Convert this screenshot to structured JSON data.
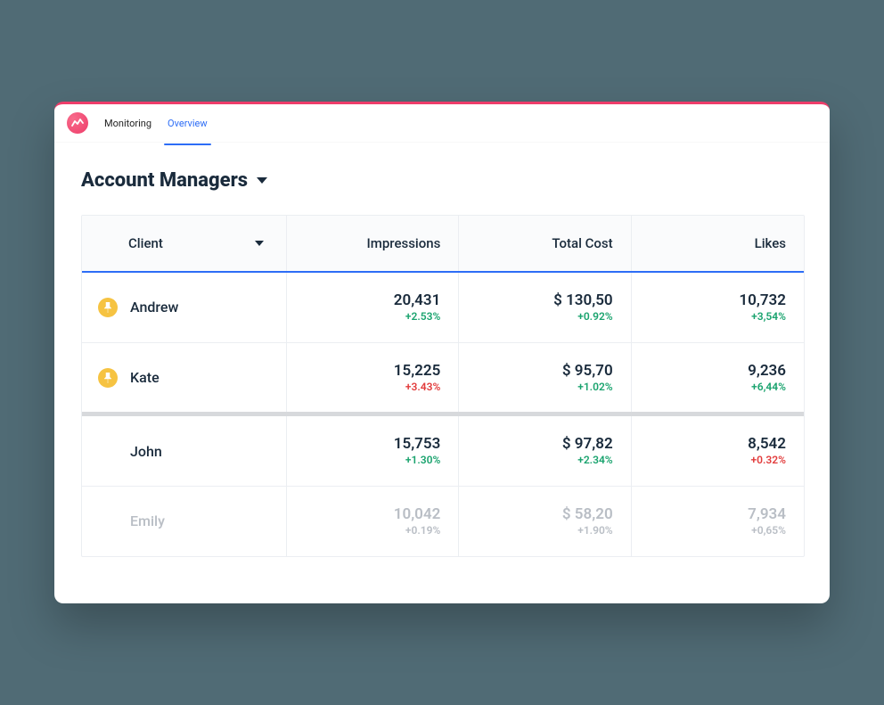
{
  "tabs": {
    "monitoring": "Monitoring",
    "overview": "Overview"
  },
  "page": {
    "title": "Account Managers"
  },
  "columns": {
    "client": "Client",
    "impressions": "Impressions",
    "total_cost": "Total Cost",
    "likes": "Likes"
  },
  "rows": [
    {
      "pinned": true,
      "name": "Andrew",
      "impressions": {
        "value": "20,431",
        "delta": "+2.53%",
        "delta_color": "pos"
      },
      "total_cost": {
        "value": "$ 130,50",
        "delta": "+0.92%",
        "delta_color": "pos"
      },
      "likes": {
        "value": "10,732",
        "delta": "+3,54%",
        "delta_color": "pos"
      }
    },
    {
      "pinned": true,
      "name": "Kate",
      "impressions": {
        "value": "15,225",
        "delta": "+3.43%",
        "delta_color": "neg"
      },
      "total_cost": {
        "value": "$ 95,70",
        "delta": "+1.02%",
        "delta_color": "pos"
      },
      "likes": {
        "value": "9,236",
        "delta": "+6,44%",
        "delta_color": "pos"
      }
    },
    {
      "pinned": false,
      "name": "John",
      "impressions": {
        "value": "15,753",
        "delta": "+1.30%",
        "delta_color": "pos"
      },
      "total_cost": {
        "value": "$ 97,82",
        "delta": "+2.34%",
        "delta_color": "pos"
      },
      "likes": {
        "value": "8,542",
        "delta": "+0.32%",
        "delta_color": "neg"
      }
    },
    {
      "pinned": false,
      "faded": true,
      "name": "Emily",
      "impressions": {
        "value": "10,042",
        "delta": "+0.19%",
        "delta_color": "pos"
      },
      "total_cost": {
        "value": "$ 58,20",
        "delta": "+1.90%",
        "delta_color": "pos"
      },
      "likes": {
        "value": "7,934",
        "delta": "+0,65%",
        "delta_color": "pos"
      }
    }
  ]
}
